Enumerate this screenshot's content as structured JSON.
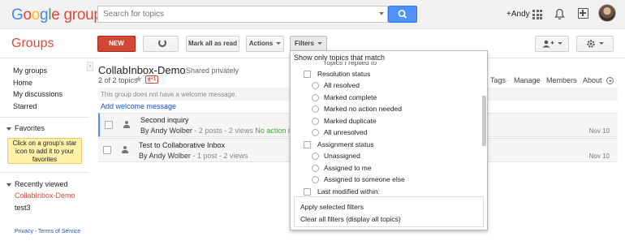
{
  "header": {
    "logo_google": "Google",
    "logo_groups": "groups",
    "search_placeholder": "Search for topics",
    "user_name": "+Andy"
  },
  "toolbar": {
    "section_title": "Groups",
    "new_topic": "NEW TOPIC",
    "mark_all_read": "Mark all as read",
    "actions": "Actions",
    "filters": "Filters"
  },
  "sidebar": {
    "nav": [
      "My groups",
      "Home",
      "My discussions",
      "Starred"
    ],
    "favorites_heading": "Favorites",
    "favorites_hint": "Click on a group's star icon to add it to your favorites",
    "recent_heading": "Recently viewed",
    "recent": [
      "CollabInbox-Demo",
      "test3"
    ],
    "footer": "Privacy - Terms of Service",
    "collapse": "‹"
  },
  "group": {
    "name": "CollabInbox-Demo",
    "visibility": "Shared privately",
    "count": "2 of 2 topics",
    "gplus": "g+1",
    "links": [
      "Tags",
      "Manage",
      "Members",
      "About"
    ],
    "welcome_note": "This group does not have a welcome message.",
    "add_welcome": "Add welcome message"
  },
  "topics": [
    {
      "title": "Second inquiry",
      "author": "By Andy Wolber",
      "meta": " - 2 posts - 2 views ",
      "status": "No action needed",
      "date": "Nov 10"
    },
    {
      "title": "Test to Collaborative Inbox",
      "author": "By Andy Wolber",
      "meta": " - 1 post - 2 views",
      "status": "",
      "date": "Nov 10"
    }
  ],
  "filter_panel": {
    "heading": "Show only topics that match",
    "partial_row": "Topics I replied to",
    "resolution_status": "Resolution status",
    "resolution_options": [
      "All resolved",
      "Marked complete",
      "Marked no action needed",
      "Marked duplicate",
      "All unresolved"
    ],
    "assignment_status": "Assignment status",
    "assignment_options": [
      "Unassigned",
      "Assigned to me",
      "Assigned to someone else"
    ],
    "last_modified": "Last modified within:",
    "apply": "Apply selected filters",
    "clear": "Clear all filters (display all topics)"
  },
  "colors": {
    "brand_red": "#dd4b39",
    "search_blue": "#4d90fe",
    "status_green": "#3aaa35",
    "link_blue": "#1155cc"
  }
}
